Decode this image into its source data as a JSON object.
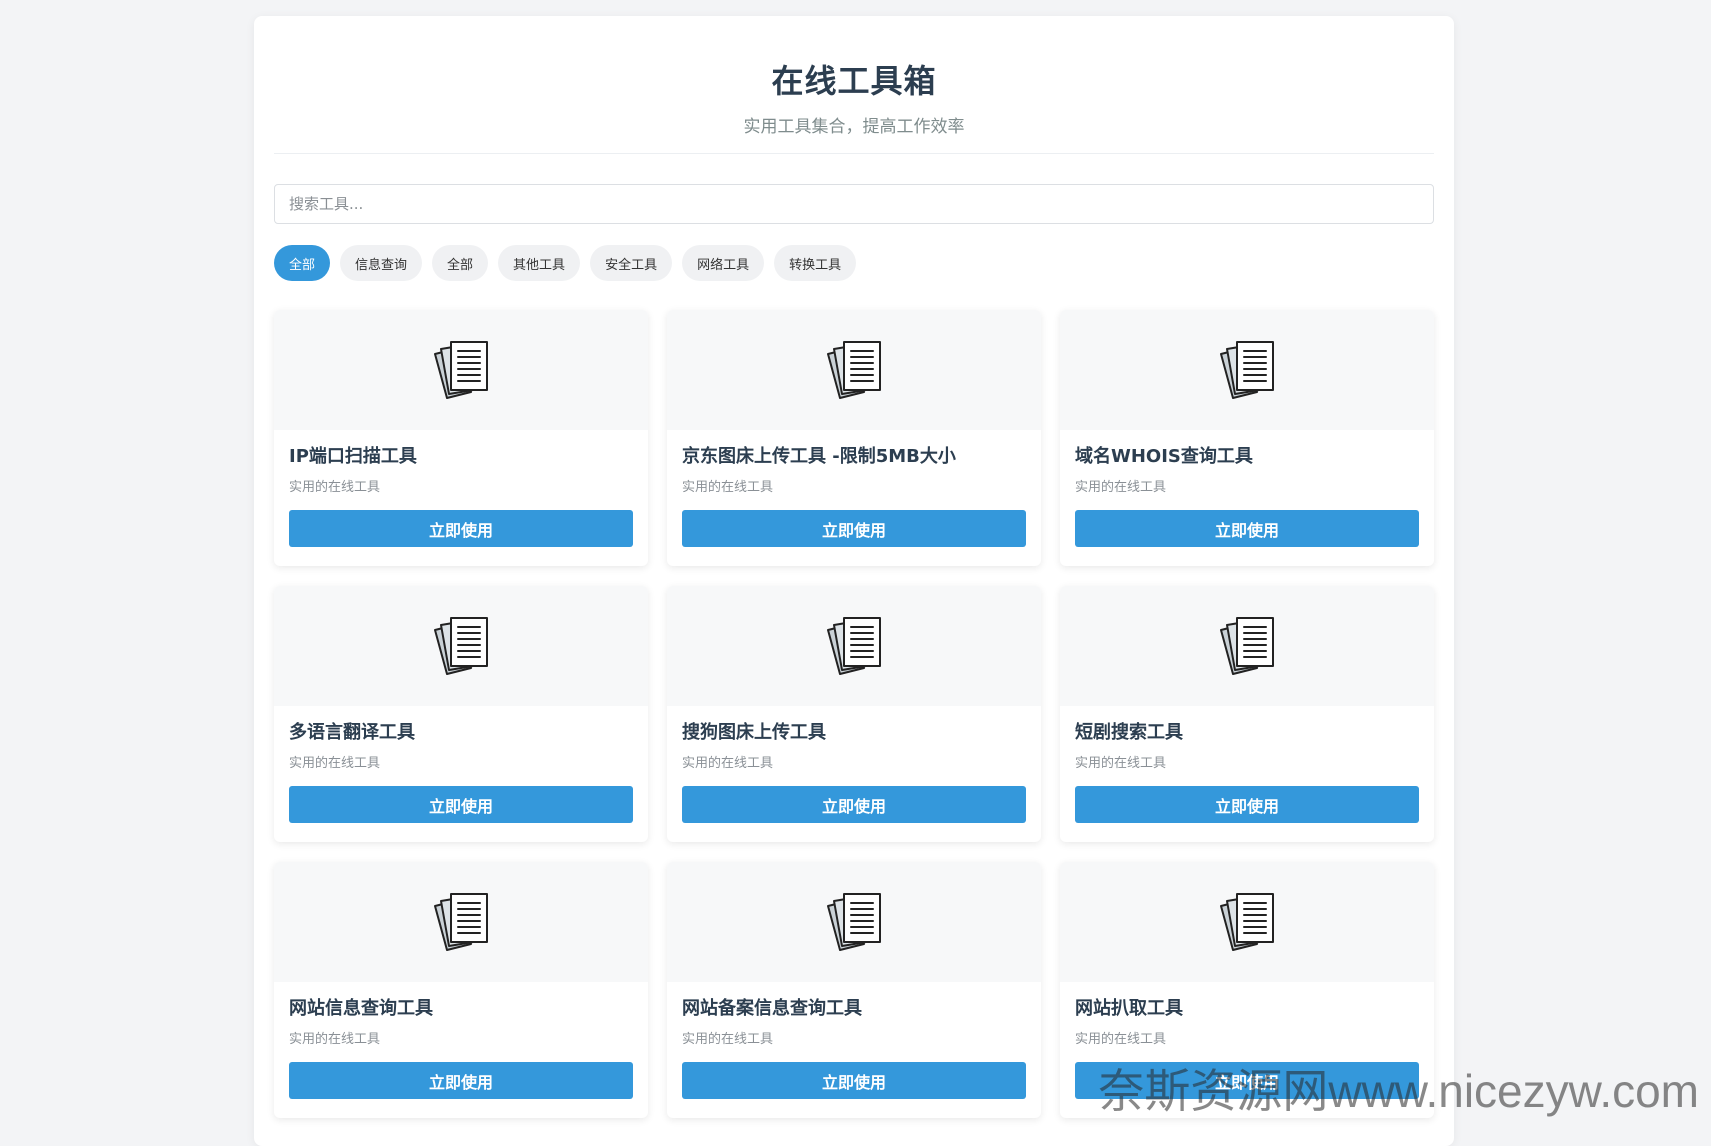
{
  "header": {
    "title": "在线工具箱",
    "subtitle": "实用工具集合，提高工作效率"
  },
  "search": {
    "placeholder": "搜索工具..."
  },
  "filters": [
    "全部",
    "信息查询",
    "全部",
    "其他工具",
    "安全工具",
    "网络工具",
    "转换工具"
  ],
  "active_filter_index": 0,
  "tools": [
    {
      "title": "IP端口扫描工具",
      "desc": "实用的在线工具",
      "button": "立即使用",
      "icon": "documents-icon"
    },
    {
      "title": "京东图床上传工具 -限制5MB大小",
      "desc": "实用的在线工具",
      "button": "立即使用",
      "icon": "documents-icon"
    },
    {
      "title": "域名WHOIS查询工具",
      "desc": "实用的在线工具",
      "button": "立即使用",
      "icon": "documents-icon"
    },
    {
      "title": "多语言翻译工具",
      "desc": "实用的在线工具",
      "button": "立即使用",
      "icon": "documents-icon"
    },
    {
      "title": "搜狗图床上传工具",
      "desc": "实用的在线工具",
      "button": "立即使用",
      "icon": "documents-icon"
    },
    {
      "title": "短剧搜索工具",
      "desc": "实用的在线工具",
      "button": "立即使用",
      "icon": "documents-icon"
    },
    {
      "title": "网站信息查询工具",
      "desc": "实用的在线工具",
      "button": "立即使用",
      "icon": "documents-icon"
    },
    {
      "title": "网站备案信息查询工具",
      "desc": "实用的在线工具",
      "button": "立即使用",
      "icon": "documents-icon"
    },
    {
      "title": "网站扒取工具",
      "desc": "实用的在线工具",
      "button": "立即使用",
      "icon": "documents-icon"
    }
  ],
  "watermark": "奈斯资源网www.nicezyw.com",
  "colors": {
    "accent": "#3498db",
    "title": "#2c3e50",
    "card_top_bg": "#f7f8f9",
    "page_bg": "#f3f4f6"
  }
}
